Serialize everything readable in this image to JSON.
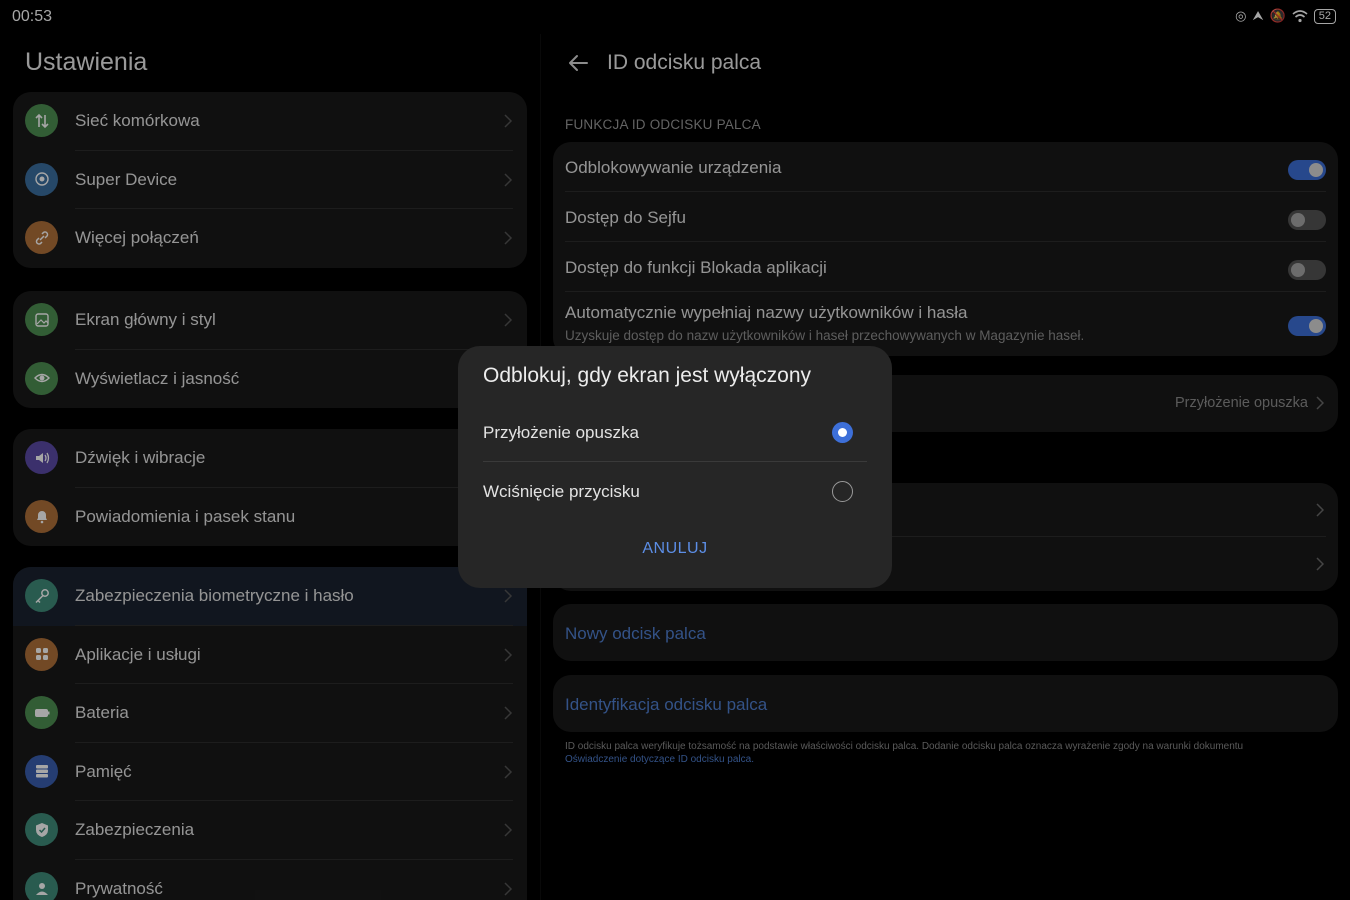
{
  "status": {
    "time": "00:53",
    "battery": "52"
  },
  "left": {
    "title": "Ustawienia",
    "groups": [
      {
        "items": [
          {
            "label": "Sieć komórkowa",
            "icon": "signal-icon",
            "color": "#4e8f52"
          },
          {
            "label": "Super Device",
            "icon": "super-device-icon",
            "color": "#3b6fa0"
          },
          {
            "label": "Więcej połączeń",
            "icon": "link-icon",
            "color": "#b0703a"
          }
        ]
      },
      {
        "items": [
          {
            "label": "Ekran główny i styl",
            "icon": "image-icon",
            "color": "#4e8f52"
          },
          {
            "label": "Wyświetlacz i jasność",
            "icon": "eye-icon",
            "color": "#4e8f52"
          }
        ]
      },
      {
        "items": [
          {
            "label": "Dźwięk i wibracje",
            "icon": "speaker-icon",
            "color": "#5b4aa6"
          },
          {
            "label": "Powiadomienia i pasek stanu",
            "icon": "bell-icon",
            "color": "#b0703a"
          }
        ]
      },
      {
        "items": [
          {
            "label": "Zabezpieczenia biometryczne i hasło",
            "icon": "key-icon",
            "color": "#3f8c7a"
          },
          {
            "label": "Aplikacje i usługi",
            "icon": "apps-icon",
            "color": "#b0703a"
          },
          {
            "label": "Bateria",
            "icon": "battery-icon",
            "color": "#4e8f52"
          },
          {
            "label": "Pamięć",
            "icon": "storage-icon",
            "color": "#3a5fb0"
          },
          {
            "label": "Zabezpieczenia",
            "icon": "shield-icon",
            "color": "#3f8c7a"
          },
          {
            "label": "Prywatność",
            "icon": "privacy-icon",
            "color": "#3f8c7a"
          }
        ]
      }
    ]
  },
  "right": {
    "title": "ID odcisku palca",
    "section_label": "FUNKCJA ID ODCISKU PALCA",
    "toggles": [
      {
        "label": "Odblokowywanie urządzenia",
        "on": true
      },
      {
        "label": "Dostęp do Sejfu",
        "on": false
      },
      {
        "label": "Dostęp do funkcji Blokada aplikacji",
        "on": false
      },
      {
        "label": "Automatycznie wypełniaj nazwy użytkowników i hasła",
        "sub": "Uzyskuje dostęp do nazw użytkowników i haseł przechowywanych w Magazynie haseł.",
        "on": true
      }
    ],
    "unlock_value": "Przyłożenie opuszka",
    "new_fingerprint": "Nowy odcisk palca",
    "identify": "Identyfikacja odcisku palca",
    "footnote": "ID odcisku palca weryfikuje tożsamość na podstawie właściwości odcisku palca. Dodanie odcisku palca oznacza wyrażenie zgody na warunki dokumentu",
    "footnote_link": "Oświadczenie dotyczące ID odcisku palca."
  },
  "dialog": {
    "title": "Odblokuj, gdy ekran jest wyłączony",
    "options": [
      {
        "label": "Przyłożenie opuszka",
        "selected": true
      },
      {
        "label": "Wciśnięcie przycisku",
        "selected": false
      }
    ],
    "cancel": "ANULUJ"
  }
}
